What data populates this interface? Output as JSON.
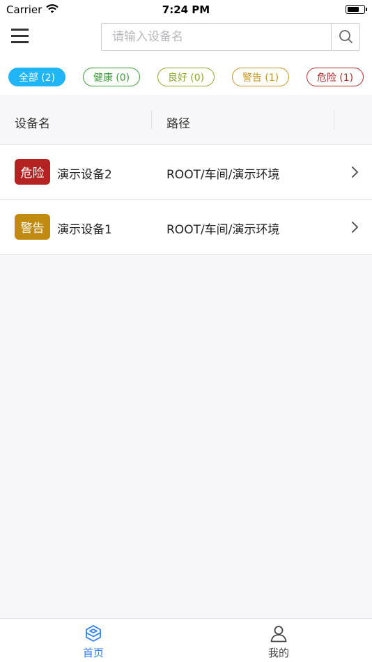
{
  "status_bar": {
    "carrier": "Carrier",
    "time": "7:24 PM",
    "battery_level": 0.75
  },
  "search": {
    "placeholder": "请输入设备名",
    "value": ""
  },
  "filters": [
    {
      "label": "全部 (2)",
      "color": "#1fb5f6",
      "selected": true
    },
    {
      "label": "健康 (0)",
      "color": "#3a9a37",
      "selected": false
    },
    {
      "label": "良好 (0)",
      "color": "#8aa62a",
      "selected": false
    },
    {
      "label": "警告 (1)",
      "color": "#c5941c",
      "selected": false
    },
    {
      "label": "危险 (1)",
      "color": "#b42a2a",
      "selected": false
    }
  ],
  "table": {
    "headers": [
      "设备名",
      "路径"
    ],
    "rows": [
      {
        "status": "危险",
        "status_color": "#b42222",
        "name": "演示设备2",
        "path": "ROOT/车间/演示环境"
      },
      {
        "status": "警告",
        "status_color": "#c18b12",
        "name": "演示设备1",
        "path": "ROOT/车间/演示环境"
      }
    ]
  },
  "tabbar": {
    "items": [
      {
        "label": "首页",
        "icon": "home-cube-icon",
        "active": true,
        "color": "#2f7ff6"
      },
      {
        "label": "我的",
        "icon": "user-icon",
        "active": false,
        "color": "#444444"
      }
    ]
  }
}
